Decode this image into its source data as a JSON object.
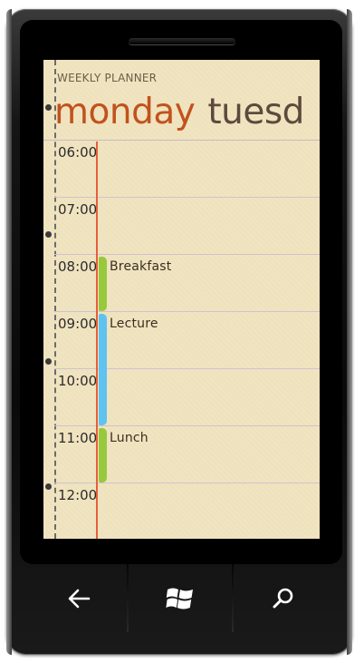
{
  "app": {
    "title": "WEEKLY PLANNER"
  },
  "pivot": {
    "active_day": "monday",
    "next_day": "tuesd"
  },
  "schedule": {
    "hours": [
      "06:00",
      "07:00",
      "08:00",
      "09:00",
      "10:00",
      "11:00",
      "12:00"
    ],
    "events": [
      {
        "label": "Breakfast",
        "start": "08:00",
        "end": "09:00",
        "color": "#97c93d"
      },
      {
        "label": "Lecture",
        "start": "09:00",
        "end": "11:00",
        "color": "#5ec3f0"
      },
      {
        "label": "Lunch",
        "start": "11:00",
        "end": "12:00",
        "color": "#97c93d"
      }
    ]
  },
  "colors": {
    "accent": "#c1521d",
    "paper": "#f1e4bf",
    "margin_line": "#e5603d"
  },
  "hardware_buttons": [
    {
      "name": "back-icon"
    },
    {
      "name": "windows-start-icon"
    },
    {
      "name": "search-icon"
    }
  ]
}
